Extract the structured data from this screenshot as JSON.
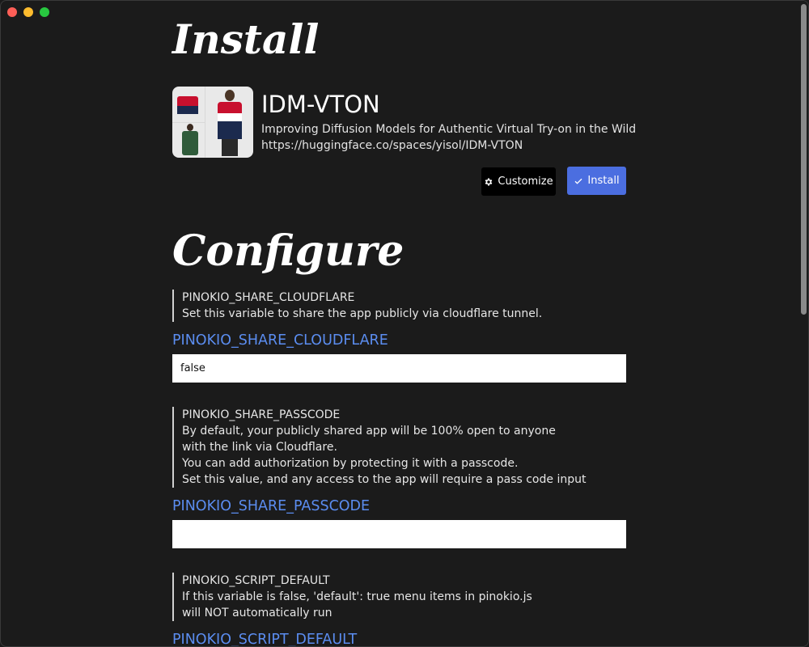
{
  "window": {
    "controls": [
      "close",
      "minimize",
      "zoom"
    ]
  },
  "install": {
    "heading": "Install",
    "app": {
      "name": "IDM-VTON",
      "description": "Improving Diffusion Models for Authentic Virtual Try-on in the Wild",
      "url": "https://huggingface.co/spaces/yisol/IDM-VTON"
    },
    "buttons": {
      "customize_label": "Customize",
      "customize_icon": "gear-icon",
      "install_label": "Install",
      "install_icon": "check-icon"
    }
  },
  "configure": {
    "heading": "Configure",
    "variables": [
      {
        "note_title": "PINOKIO_SHARE_CLOUDFLARE",
        "note_lines": [
          "Set this variable to share the app publicly via cloudflare tunnel."
        ],
        "label": "PINOKIO_SHARE_CLOUDFLARE",
        "value": "false"
      },
      {
        "note_title": "PINOKIO_SHARE_PASSCODE",
        "note_lines": [
          "By default, your publicly shared app will be 100% open to anyone",
          "with the link via Cloudflare.",
          "You can add authorization by protecting it with a passcode.",
          "Set this value, and any access to the app will require a pass code input"
        ],
        "label": "PINOKIO_SHARE_PASSCODE",
        "value": ""
      },
      {
        "note_title": "PINOKIO_SCRIPT_DEFAULT",
        "note_lines": [
          "If this variable is false, 'default': true menu items in pinokio.js",
          "will NOT automatically run"
        ],
        "label": "PINOKIO_SCRIPT_DEFAULT",
        "value": ""
      }
    ]
  },
  "colors": {
    "background": "#1b1b1b",
    "accent_blue": "#4b6ee0",
    "label_blue": "#5b8df0"
  }
}
